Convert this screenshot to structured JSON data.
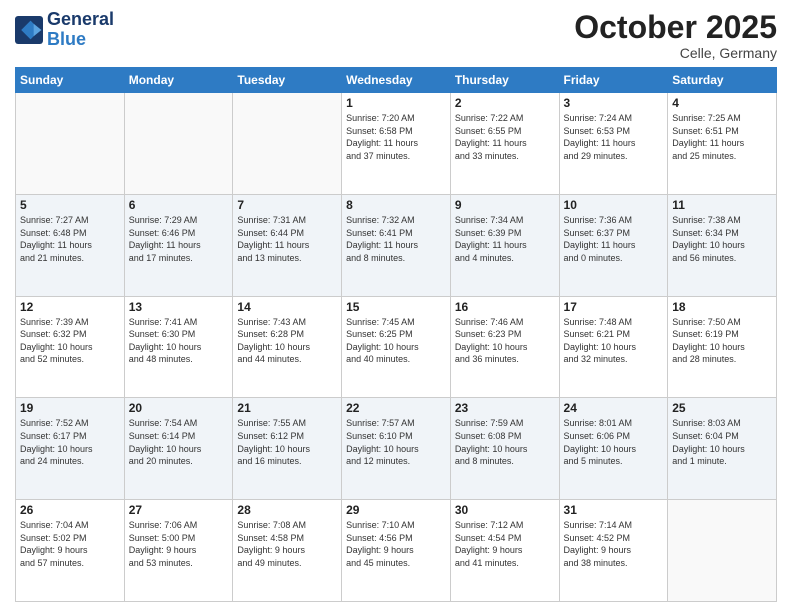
{
  "header": {
    "logo_line1": "General",
    "logo_line2": "Blue",
    "month": "October 2025",
    "location": "Celle, Germany"
  },
  "weekdays": [
    "Sunday",
    "Monday",
    "Tuesday",
    "Wednesday",
    "Thursday",
    "Friday",
    "Saturday"
  ],
  "weeks": [
    [
      {
        "day": "",
        "info": ""
      },
      {
        "day": "",
        "info": ""
      },
      {
        "day": "",
        "info": ""
      },
      {
        "day": "1",
        "info": "Sunrise: 7:20 AM\nSunset: 6:58 PM\nDaylight: 11 hours\nand 37 minutes."
      },
      {
        "day": "2",
        "info": "Sunrise: 7:22 AM\nSunset: 6:55 PM\nDaylight: 11 hours\nand 33 minutes."
      },
      {
        "day": "3",
        "info": "Sunrise: 7:24 AM\nSunset: 6:53 PM\nDaylight: 11 hours\nand 29 minutes."
      },
      {
        "day": "4",
        "info": "Sunrise: 7:25 AM\nSunset: 6:51 PM\nDaylight: 11 hours\nand 25 minutes."
      }
    ],
    [
      {
        "day": "5",
        "info": "Sunrise: 7:27 AM\nSunset: 6:48 PM\nDaylight: 11 hours\nand 21 minutes."
      },
      {
        "day": "6",
        "info": "Sunrise: 7:29 AM\nSunset: 6:46 PM\nDaylight: 11 hours\nand 17 minutes."
      },
      {
        "day": "7",
        "info": "Sunrise: 7:31 AM\nSunset: 6:44 PM\nDaylight: 11 hours\nand 13 minutes."
      },
      {
        "day": "8",
        "info": "Sunrise: 7:32 AM\nSunset: 6:41 PM\nDaylight: 11 hours\nand 8 minutes."
      },
      {
        "day": "9",
        "info": "Sunrise: 7:34 AM\nSunset: 6:39 PM\nDaylight: 11 hours\nand 4 minutes."
      },
      {
        "day": "10",
        "info": "Sunrise: 7:36 AM\nSunset: 6:37 PM\nDaylight: 11 hours\nand 0 minutes."
      },
      {
        "day": "11",
        "info": "Sunrise: 7:38 AM\nSunset: 6:34 PM\nDaylight: 10 hours\nand 56 minutes."
      }
    ],
    [
      {
        "day": "12",
        "info": "Sunrise: 7:39 AM\nSunset: 6:32 PM\nDaylight: 10 hours\nand 52 minutes."
      },
      {
        "day": "13",
        "info": "Sunrise: 7:41 AM\nSunset: 6:30 PM\nDaylight: 10 hours\nand 48 minutes."
      },
      {
        "day": "14",
        "info": "Sunrise: 7:43 AM\nSunset: 6:28 PM\nDaylight: 10 hours\nand 44 minutes."
      },
      {
        "day": "15",
        "info": "Sunrise: 7:45 AM\nSunset: 6:25 PM\nDaylight: 10 hours\nand 40 minutes."
      },
      {
        "day": "16",
        "info": "Sunrise: 7:46 AM\nSunset: 6:23 PM\nDaylight: 10 hours\nand 36 minutes."
      },
      {
        "day": "17",
        "info": "Sunrise: 7:48 AM\nSunset: 6:21 PM\nDaylight: 10 hours\nand 32 minutes."
      },
      {
        "day": "18",
        "info": "Sunrise: 7:50 AM\nSunset: 6:19 PM\nDaylight: 10 hours\nand 28 minutes."
      }
    ],
    [
      {
        "day": "19",
        "info": "Sunrise: 7:52 AM\nSunset: 6:17 PM\nDaylight: 10 hours\nand 24 minutes."
      },
      {
        "day": "20",
        "info": "Sunrise: 7:54 AM\nSunset: 6:14 PM\nDaylight: 10 hours\nand 20 minutes."
      },
      {
        "day": "21",
        "info": "Sunrise: 7:55 AM\nSunset: 6:12 PM\nDaylight: 10 hours\nand 16 minutes."
      },
      {
        "day": "22",
        "info": "Sunrise: 7:57 AM\nSunset: 6:10 PM\nDaylight: 10 hours\nand 12 minutes."
      },
      {
        "day": "23",
        "info": "Sunrise: 7:59 AM\nSunset: 6:08 PM\nDaylight: 10 hours\nand 8 minutes."
      },
      {
        "day": "24",
        "info": "Sunrise: 8:01 AM\nSunset: 6:06 PM\nDaylight: 10 hours\nand 5 minutes."
      },
      {
        "day": "25",
        "info": "Sunrise: 8:03 AM\nSunset: 6:04 PM\nDaylight: 10 hours\nand 1 minute."
      }
    ],
    [
      {
        "day": "26",
        "info": "Sunrise: 7:04 AM\nSunset: 5:02 PM\nDaylight: 9 hours\nand 57 minutes."
      },
      {
        "day": "27",
        "info": "Sunrise: 7:06 AM\nSunset: 5:00 PM\nDaylight: 9 hours\nand 53 minutes."
      },
      {
        "day": "28",
        "info": "Sunrise: 7:08 AM\nSunset: 4:58 PM\nDaylight: 9 hours\nand 49 minutes."
      },
      {
        "day": "29",
        "info": "Sunrise: 7:10 AM\nSunset: 4:56 PM\nDaylight: 9 hours\nand 45 minutes."
      },
      {
        "day": "30",
        "info": "Sunrise: 7:12 AM\nSunset: 4:54 PM\nDaylight: 9 hours\nand 41 minutes."
      },
      {
        "day": "31",
        "info": "Sunrise: 7:14 AM\nSunset: 4:52 PM\nDaylight: 9 hours\nand 38 minutes."
      },
      {
        "day": "",
        "info": ""
      }
    ]
  ]
}
